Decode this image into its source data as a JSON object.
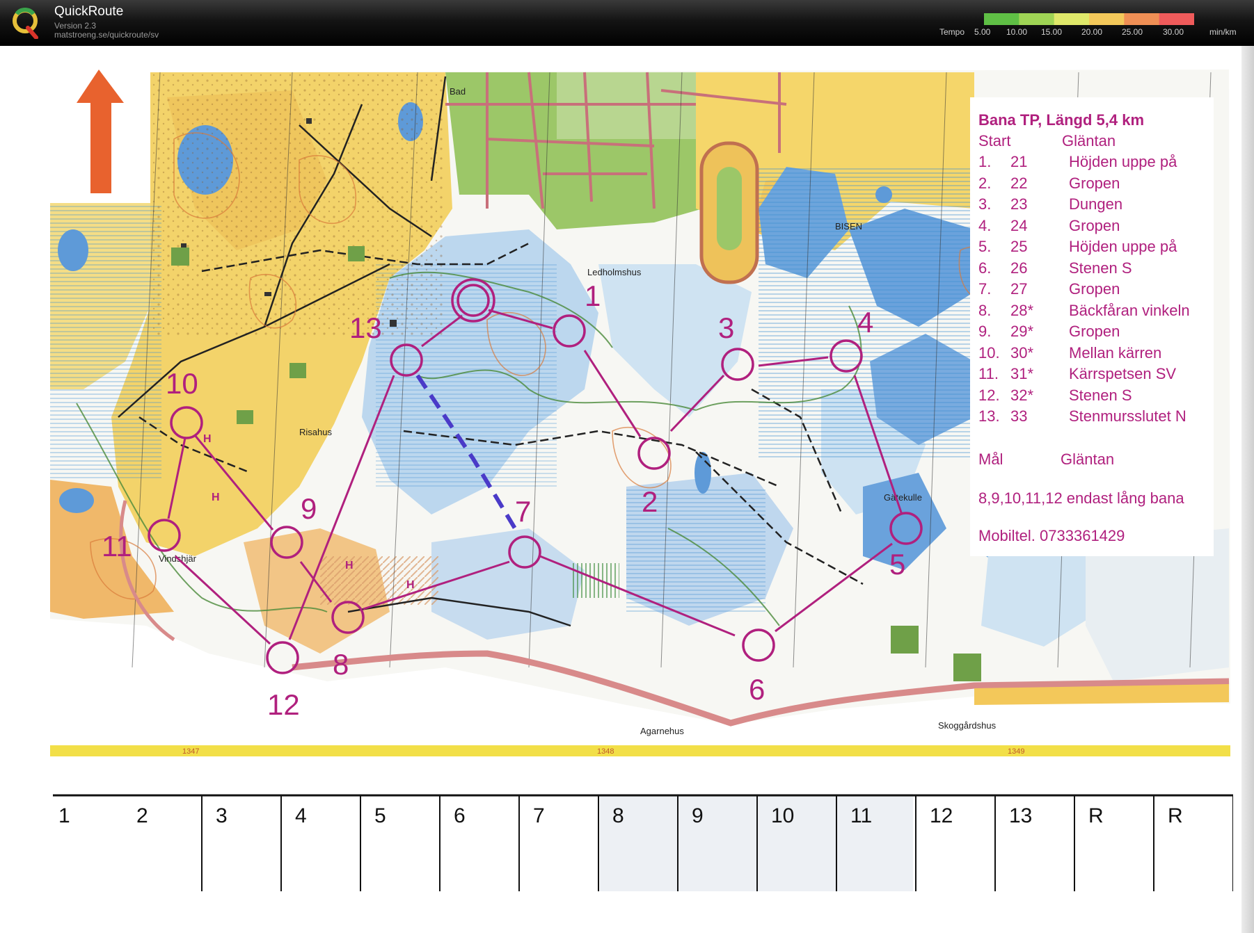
{
  "app": {
    "name": "QuickRoute",
    "version": "Version 2.3",
    "url": "matstroeng.se/quickroute/sv"
  },
  "tempo": {
    "label": "Tempo",
    "ticks": [
      "5.00",
      "10.00",
      "15.00",
      "20.00",
      "25.00",
      "30.00"
    ],
    "unit": "min/km",
    "colors": [
      "#5fbf45",
      "#9fd455",
      "#dfe86a",
      "#f3c85a",
      "#ef8f55",
      "#ef5b5b"
    ]
  },
  "map": {
    "legend": {
      "title": "Bana TP,  Längd 5,4 km",
      "start": {
        "label": "Start",
        "name": "Gläntan"
      },
      "controls": [
        {
          "n": "1.",
          "code": "21",
          "desc": "Höjden uppe på"
        },
        {
          "n": "2.",
          "code": "22",
          "desc": "Gropen"
        },
        {
          "n": "3.",
          "code": "23",
          "desc": "Dungen"
        },
        {
          "n": "4.",
          "code": "24",
          "desc": "Gropen"
        },
        {
          "n": "5.",
          "code": "25",
          "desc": "Höjden uppe på"
        },
        {
          "n": "6.",
          "code": "26",
          "desc": "Stenen S"
        },
        {
          "n": "7.",
          "code": "27",
          "desc": "Gropen"
        },
        {
          "n": "8.",
          "code": "28*",
          "desc": "Bäckfåran vinkeln"
        },
        {
          "n": "9.",
          "code": "29*",
          "desc": "Gropen"
        },
        {
          "n": "10.",
          "code": "30*",
          "desc": "Mellan kärren"
        },
        {
          "n": "11.",
          "code": "31*",
          "desc": "Kärrspetsen SV"
        },
        {
          "n": "12.",
          "code": "32*",
          "desc": "Stenen S"
        },
        {
          "n": "13.",
          "code": "33",
          "desc": "Stenmursslutet N"
        }
      ],
      "finish": {
        "label": "Mål",
        "name": "Gläntan"
      },
      "note": "8,9,10,11,12 endast lång bana",
      "phone": "Mobiltel. 0733361429"
    },
    "places": [
      "Bad",
      "Ledholmshus",
      "BISEN",
      "Risahus",
      "Vindshjär",
      "Gätekulle",
      "Agarnehus",
      "Skoggårdshus"
    ],
    "grid_marks": [
      "1347",
      "1348",
      "1349"
    ],
    "control_labels": [
      "1",
      "2",
      "3",
      "4",
      "5",
      "6",
      "7",
      "8",
      "9",
      "10",
      "11",
      "12",
      "13"
    ],
    "split_labels": [
      "1",
      "2",
      "3",
      "4",
      "5",
      "6",
      "7",
      "8",
      "9",
      "10",
      "11",
      "12",
      "13",
      "R",
      "R"
    ]
  }
}
